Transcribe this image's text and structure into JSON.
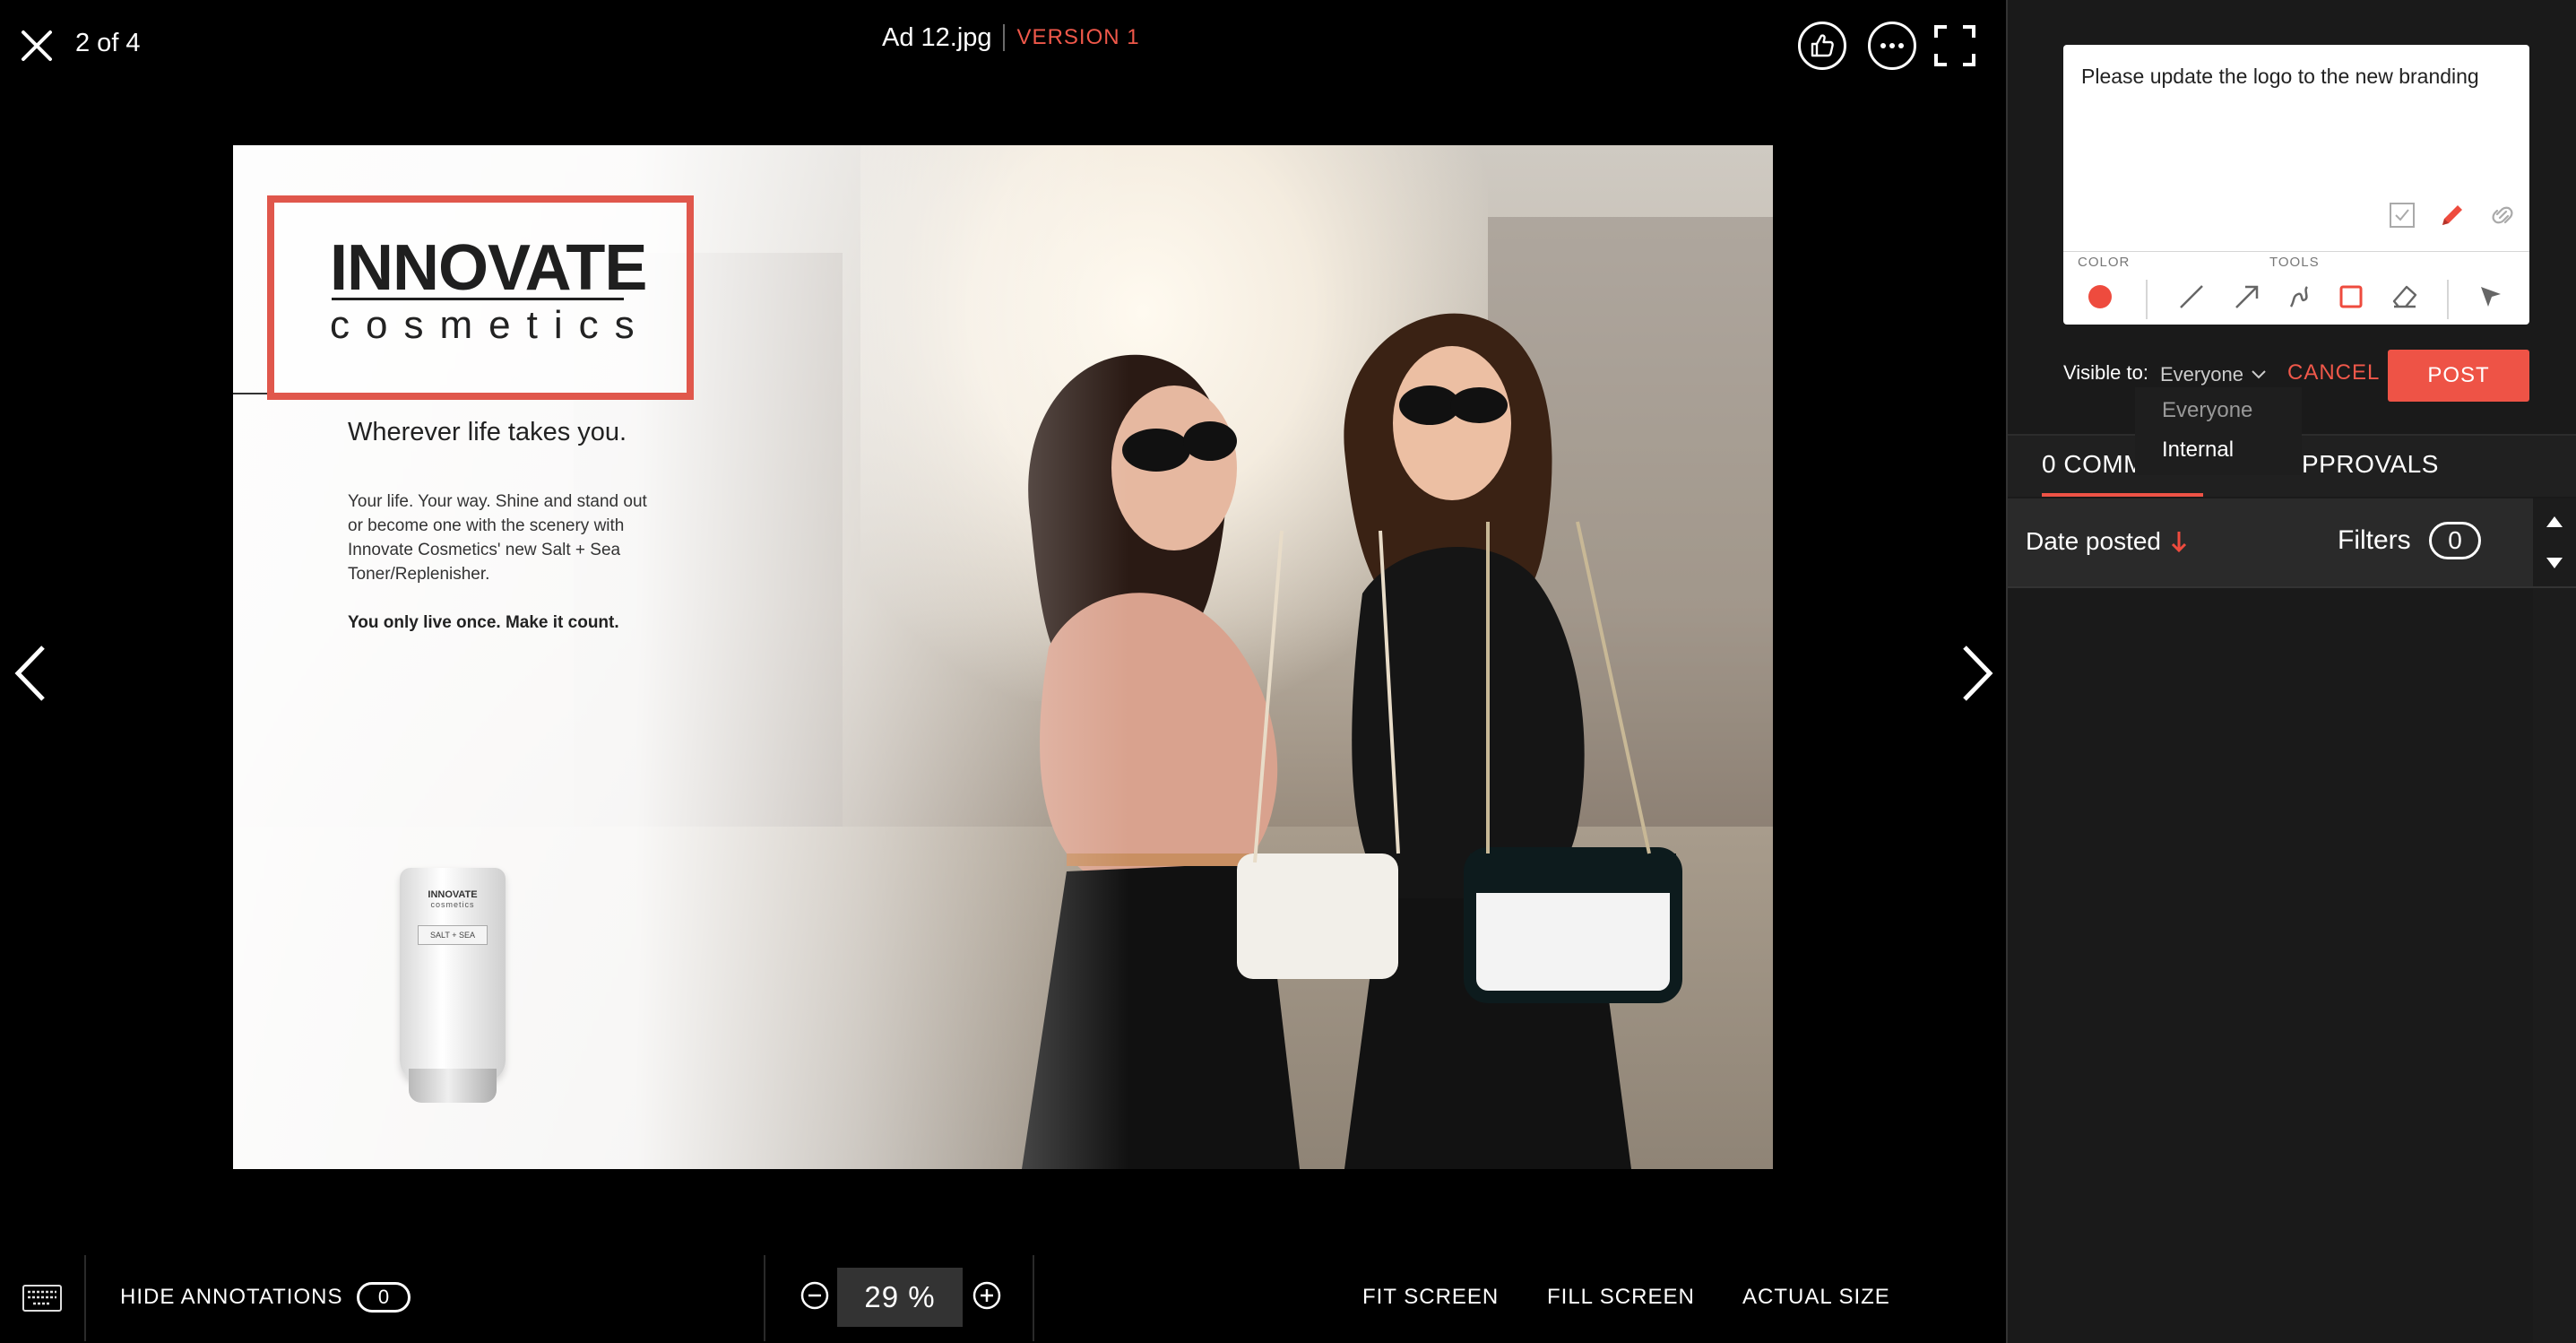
{
  "header": {
    "counter": "2 of 4",
    "file_name": "Ad 12.jpg",
    "version": "VERSION 1"
  },
  "ad": {
    "brand_line1": "INNOVATE",
    "brand_line2": "cosmetics",
    "tagline": "Wherever life takes you.",
    "body": "Your life. Your way. Shine and stand out or become one with the scenery with Innovate Cosmetics' new Salt + Sea Toner/Replenisher.",
    "cta": "You only live once. Make it count.",
    "tube_brand": "INNOVATE",
    "tube_sub": "cosmetics",
    "tube_label": "SALT + SEA"
  },
  "bottom_bar": {
    "hide_annotations": "HIDE ANNOTATIONS",
    "annotation_count": "0",
    "zoom": "29 %",
    "fit_screen": "FIT SCREEN",
    "fill_screen": "FILL SCREEN",
    "actual_size": "ACTUAL SIZE"
  },
  "comment": {
    "text": "Please update the logo to the new branding",
    "color_label": "COLOR",
    "tools_label": "TOOLS",
    "selected_color": "#ee4b3e",
    "visible_label": "Visible to:",
    "visible_value": "Everyone",
    "cancel": "CANCEL",
    "post": "POST",
    "visibility_options": [
      "Everyone",
      "Internal"
    ]
  },
  "tabs": {
    "comments": "0 COMM",
    "approvals": "PPROVALS"
  },
  "sort": {
    "date_posted": "Date posted",
    "filters": "Filters",
    "filter_count": "0"
  },
  "colors": {
    "accent": "#ee5346",
    "panel_bg": "#1a1a1a",
    "viewer_bg": "#000000"
  }
}
